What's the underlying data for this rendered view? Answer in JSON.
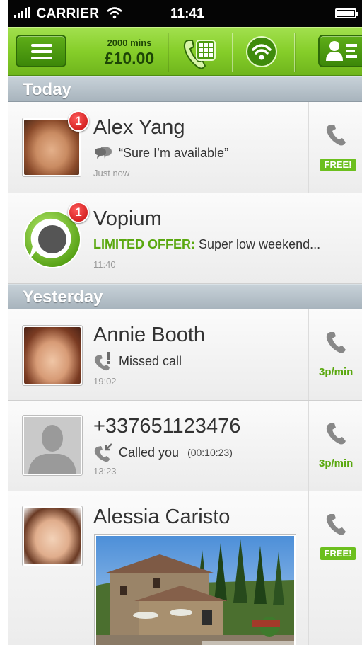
{
  "status_bar": {
    "carrier": "CARRIER",
    "time": "11:41"
  },
  "toolbar": {
    "minutes": "2000 mins",
    "balance": "£10.00"
  },
  "sections": {
    "today": "Today",
    "yesterday": "Yesterday"
  },
  "entries": [
    {
      "name": "Alex Yang",
      "message": "“Sure I’m available”",
      "time": "Just now",
      "badge": "1",
      "call_tag": "FREE!"
    },
    {
      "name": "Vopium",
      "offer_label": "LIMITED OFFER:",
      "message": "Super low weekend...",
      "time": "11:40",
      "badge": "1"
    },
    {
      "name": "Annie Booth",
      "message": "Missed call",
      "time": "19:02",
      "rate": "3p/min"
    },
    {
      "name": "+337651123476",
      "message": "Called you",
      "duration": "(00:10:23)",
      "time": "13:23",
      "rate": "3p/min"
    },
    {
      "name": "Alessia Caristo",
      "call_tag": "FREE!"
    }
  ],
  "colors": {
    "accent_green": "#86ce2a",
    "offer_green": "#5aa80f",
    "badge_red": "#d31515",
    "section_gray": "#b4bfc7"
  },
  "icons": [
    "menu-icon",
    "dialpad-icon",
    "wifi-call-icon",
    "contacts-icon",
    "phone-icon",
    "chat-bubble-icon",
    "missed-call-icon",
    "incoming-call-icon"
  ]
}
